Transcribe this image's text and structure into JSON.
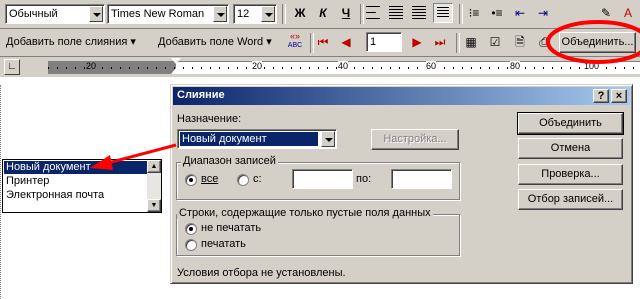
{
  "toolbar1": {
    "style": "Обычный",
    "font": "Times New Roman",
    "size": "12",
    "bold": "Ж",
    "italic": "К",
    "underline": "Ч"
  },
  "toolbar2": {
    "insert_merge_field": "Добавить поле слияния",
    "insert_word_field": "Добавить поле Word",
    "abc_label": "«»",
    "abc_sub": "ABC",
    "record_number": "1",
    "merge_button": "Объединить..."
  },
  "ruler": {
    "ticks": [
      "20",
      "20",
      "40",
      "60",
      "80",
      "100"
    ]
  },
  "dialog": {
    "title": "Слияние",
    "help_button": "?",
    "close_button": "×",
    "destination_label": "Назначение:",
    "destination_value": "Новый документ",
    "setup_button": "Настройка...",
    "range_group": "Диапазон записей",
    "range_all": "все",
    "range_from": "с:",
    "range_to": "по:",
    "blank_group": "Строки, содержащие только пустые поля данных",
    "blank_dont_print": "не печатать",
    "blank_print": "печатать",
    "status": "Условия отбора не установлены.",
    "merge_button": "Объединить",
    "cancel_button": "Отмена",
    "check_button": "Проверка...",
    "query_button": "Отбор записей..."
  },
  "dropdown": {
    "options": [
      "Новый документ",
      "Принтер",
      "Электронная почта"
    ]
  },
  "colors": {
    "face": "#d4d0c8",
    "title_start": "#0a246a",
    "title_end": "#a6caf0",
    "selection": "#0a246a",
    "annotation": "#ff0000"
  }
}
